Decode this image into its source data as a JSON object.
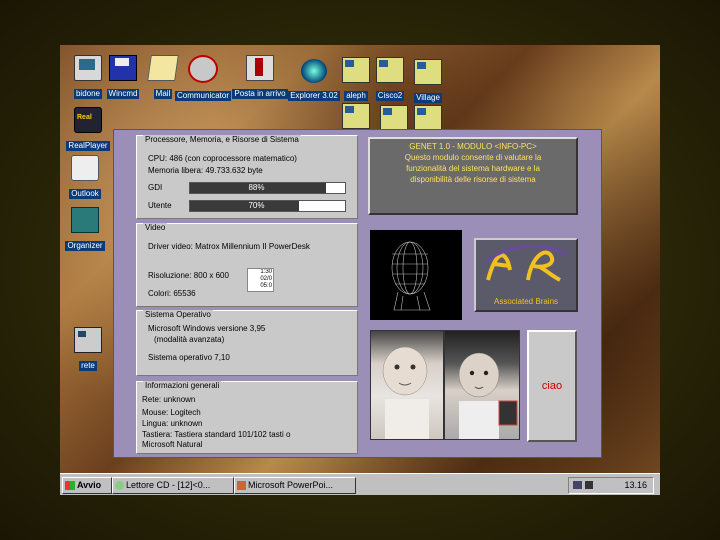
{
  "desktop": {
    "icons": [
      {
        "label": "bidone",
        "icon": "recycle-bin-icon"
      },
      {
        "label": "Wincmd",
        "icon": "floppy-disk-icon"
      },
      {
        "label": "Mail",
        "icon": "mail-icon"
      },
      {
        "label": "Communicator",
        "icon": "communicator-icon"
      },
      {
        "label": "Posta in arrivo",
        "icon": "inbox-icon"
      },
      {
        "label": "Explorer 3.02",
        "icon": "internet-explorer-icon"
      },
      {
        "label": "aleph",
        "icon": "network-computer-icon"
      },
      {
        "label": "Cisco2",
        "icon": "network-computer-icon"
      },
      {
        "label": "Village",
        "icon": "network-computer-icon"
      },
      {
        "label": "RealPlayer",
        "icon": "realplayer-icon"
      },
      {
        "label": "Outlook",
        "icon": "outlook-icon"
      },
      {
        "label": "Organizer",
        "icon": "organizer-icon"
      },
      {
        "label": "rete",
        "icon": "network-neighborhood-icon"
      }
    ]
  },
  "app": {
    "cpu_panel": {
      "title": "Processore, Memoria, e Risorse di Sistema",
      "cpu": "CPU: 486 (con coprocessore matematico)",
      "memory": "Memoria libera: 49.733.632 byte",
      "gdi_label": "GDI",
      "gdi_value": "88%",
      "gdi_fraction": 0.88,
      "user_label": "Utente",
      "user_value": "70%",
      "user_fraction": 0.7
    },
    "video_panel": {
      "title": "Video",
      "driver": "Driver video: Matrox Millennium II PowerDesk",
      "resolution": "Risoluzione:  800 x 600",
      "colors": "Colori:  65536",
      "spin_values": [
        "1:30",
        "02/0",
        "05:0"
      ]
    },
    "os_panel": {
      "title": "Sistema Operativo",
      "version": "Microsoft Windows versione 3,95",
      "mode": "(modalità avanzata)",
      "system": "Sistema operativo 7,10"
    },
    "general_panel": {
      "title": "Informazioni generali",
      "network": "Rete: unknown",
      "mouse": "Mouse: Logitech",
      "language": "Lingua: unknown",
      "keyboard": "Tastiera: Tastiera standard 101/102 tasti o",
      "keyboard2": "Microsoft Natural"
    },
    "info_text": {
      "line1": "GENET 1.0 - MODULO <INFO-PC>",
      "line2": "Questo modulo consente di valutare la",
      "line3": "funzionalità del sistema hardware e la",
      "line4": "disponibilità delle risorse di sistema"
    },
    "logo_caption": "Associated Brains",
    "ciao_label": "ciao"
  },
  "taskbar": {
    "start_label": "Avvio",
    "tasks": [
      "Lettore CD - [12]<0...",
      "Microsoft PowerPoi..."
    ],
    "clock": "13.16"
  },
  "colors": {
    "info_text": "#ffe060",
    "desktop_label_bg": "#0a3a7a",
    "app_bg": "#9b8fb8",
    "ciao_text": "#cc0000"
  }
}
